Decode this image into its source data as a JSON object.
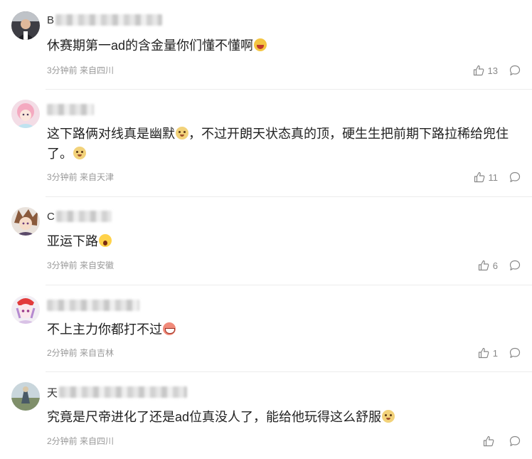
{
  "comments": [
    {
      "name_initial": "B",
      "text": "休赛期第一ad的含金量你们懂不懂啊",
      "emoji": "laugh-emoji",
      "meta": "3分钟前 来自四川",
      "likes": "13"
    },
    {
      "name_initial": "",
      "text": "这下路俩对线真是幽默",
      "emoji": "doge-emoji",
      "text2": "，不过开朗天状态真的顶，硬生生把前期下路拉稀给兜住了。",
      "emoji2": "doge-emoji",
      "meta": "3分钟前 来自天津",
      "likes": "11"
    },
    {
      "name_initial": "C",
      "text": "亚运下路",
      "emoji": "shock-emoji",
      "meta": "3分钟前 来自安徽",
      "likes": "6"
    },
    {
      "name_initial": "",
      "text": "不上主力你都打不过",
      "emoji": "grin-emoji",
      "meta": "2分钟前 来自吉林",
      "likes": "1"
    },
    {
      "name_initial": "天",
      "text": "究竟是尺帝进化了还是ad位真没人了，能给他玩得这么舒服",
      "emoji": "doge-emoji",
      "meta": "2分钟前 来自四川",
      "likes": ""
    }
  ],
  "icons": {
    "like": "thumbs-up-icon",
    "reply": "comment-bubble-icon"
  },
  "colors": {
    "text": "#222222",
    "meta": "#999999",
    "divider": "#ececec"
  }
}
